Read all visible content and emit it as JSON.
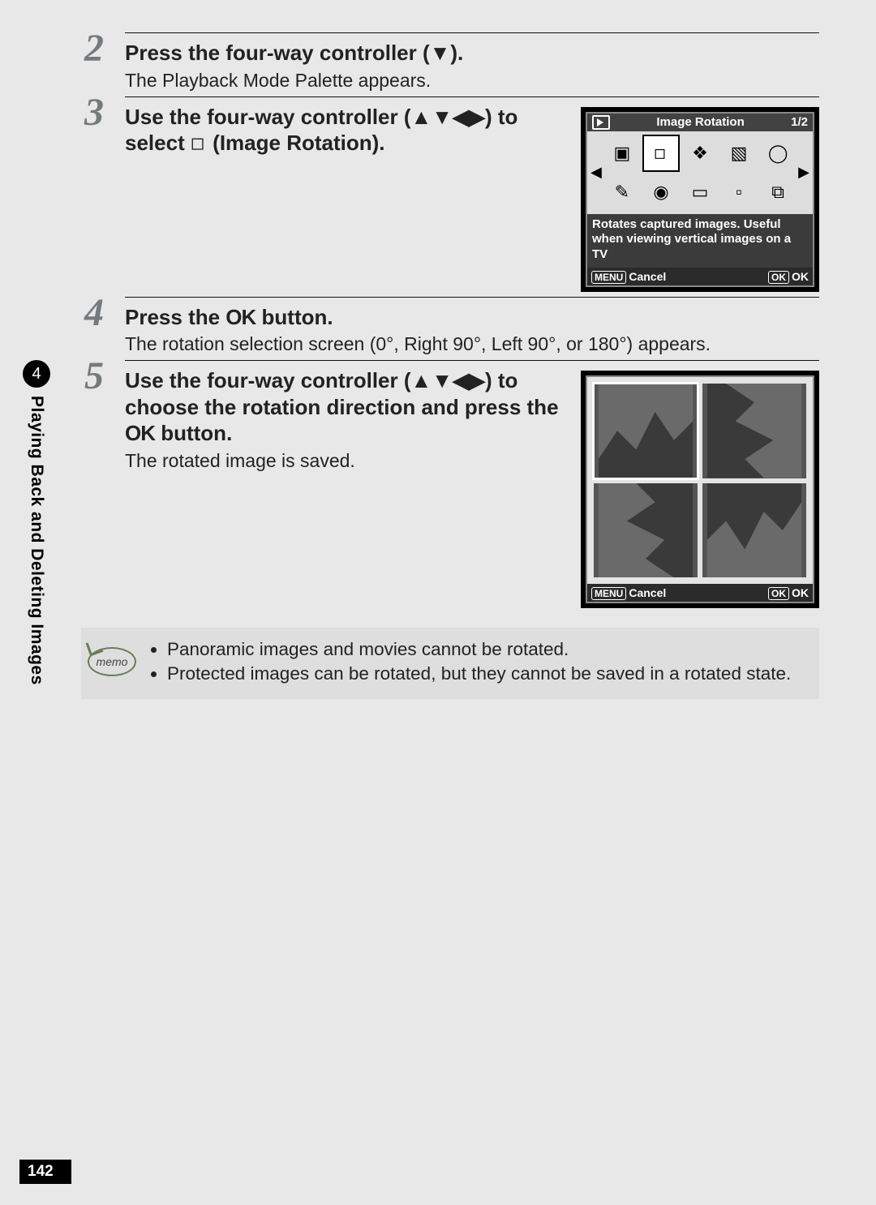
{
  "sidebar": {
    "chapter_num": "4",
    "chapter_title": "Playing Back and Deleting Images"
  },
  "steps": [
    {
      "num": "2",
      "heading_parts": [
        "Press the four-way controller (",
        "▼",
        ")."
      ],
      "desc": "The Playback Mode Palette appears."
    },
    {
      "num": "3",
      "heading_parts": [
        "Use the four-way controller (",
        "▲▼◀▶",
        ") to select ",
        "◇",
        " (Image Rotation)."
      ],
      "lcd": {
        "title": "Image Rotation",
        "page": "1/2",
        "desc": "Rotates captured images. Useful when viewing vertical images on a TV",
        "menu_label": "MENU",
        "cancel": "Cancel",
        "ok_btn": "OK",
        "ok_label": "OK"
      }
    },
    {
      "num": "4",
      "heading_parts": [
        "Press the ",
        "OK",
        " button."
      ],
      "desc": "The rotation selection screen (0°, Right 90°, Left 90°, or 180°) appears."
    },
    {
      "num": "5",
      "heading_parts": [
        "Use the four-way controller (",
        "▲▼◀▶",
        ") to choose the rotation direction and press the ",
        "OK",
        " button."
      ],
      "desc": "The rotated image is saved.",
      "lcd": {
        "menu_label": "MENU",
        "cancel": "Cancel",
        "ok_btn": "OK",
        "ok_label": "OK"
      }
    }
  ],
  "memo": {
    "label": "memo",
    "items": [
      "Panoramic images and movies cannot be rotated.",
      "Protected images can be rotated, but they cannot be saved in a rotated state."
    ]
  },
  "page_number": "142"
}
